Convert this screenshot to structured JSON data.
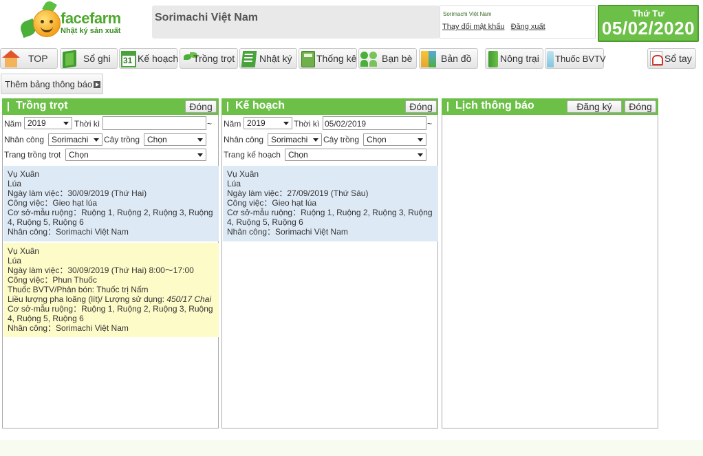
{
  "header": {
    "logo_text": "facefarm",
    "logo_sub": "Nhật ký sản xuất",
    "company": "Sorimachi Việt Nam",
    "user_name": "Sorimachi Việt Nam",
    "change_password": "Thay đổi mật khẩu",
    "logout": "Đăng xuất",
    "day_of_week": "Thứ Tư",
    "date": "05/02/2020"
  },
  "nav": {
    "top": "TOP",
    "so_ghi": "Sổ ghi",
    "ke_hoach": "Kế hoạch",
    "trong_trot": "Trồng trọt",
    "nhat_ky": "Nhật ký",
    "thong_ke": "Thống kê",
    "ban_be": "Bạn bè",
    "ban_do": "Bản đồ",
    "nong_trai": "Nông trại",
    "thuoc_bvtv": "Thuốc BVTV",
    "so_tay": "Sổ tay"
  },
  "notice_button": "Thêm bảng thông báo",
  "panels": {
    "trong_trot": {
      "title": "Trồng trọt",
      "close": "Đóng",
      "year_label": "Năm",
      "year_value": "2019",
      "period_label": "Thời kì",
      "period_value": "",
      "tilde": "~",
      "worker_label": "Nhân công",
      "worker_value": "Sorimachi",
      "crop_label": "Cây trồng",
      "crop_value": "Chọn",
      "page_label": "Trang trồng trọt",
      "page_value": "Chọn",
      "entries": [
        {
          "season": "Vụ Xuân",
          "crop": "Lúa",
          "workday": "Ngày làm việc：30/09/2019 (Thứ Hai)",
          "task": "Công việc：Gieo hạt lúa",
          "field_1": "Cơ sở-mẫu ruộng：Ruộng 1, Ruộng 2, Ruộng 3, Ruộng",
          "field_2": "4, Ruộng 5, Ruộng 6",
          "worker": "Nhân công：Sorimachi Việt Nam"
        },
        {
          "season": "Vụ Xuân",
          "crop": "Lúa",
          "workday": "Ngày làm việc：30/09/2019 (Thứ Hai)  8:00～17:00",
          "task": "Công việc：Phun Thuốc",
          "pesticide": "Thuốc BVTV/Phân bón: Thuốc trị Nấm",
          "dosage_label": "Liều lượng pha loãng (lít)/ Lượng sử dụng: ",
          "dosage_value": "450/17 Chai",
          "field_1": "Cơ sở-mẫu ruộng：Ruộng 1, Ruộng 2, Ruộng 3, Ruộng",
          "field_2": "4, Ruộng 5, Ruộng 6",
          "worker": "Nhân công：Sorimachi Việt Nam"
        }
      ]
    },
    "ke_hoach": {
      "title": "Kế hoạch",
      "close": "Đóng",
      "year_label": "Năm",
      "year_value": "2019",
      "period_label": "Thời kì",
      "period_value": "05/02/2019",
      "tilde": "~",
      "worker_label": "Nhân công",
      "worker_value": "Sorimachi",
      "crop_label": "Cây trồng",
      "crop_value": "Chọn",
      "page_label": "Trang kế hoạch",
      "page_value": "Chọn",
      "entries": [
        {
          "season": "Vụ Xuân",
          "crop": "Lúa",
          "workday": "Ngày làm việc：27/09/2019 (Thứ Sáu)",
          "task": "Công việc：Gieo hạt lúa",
          "field_1": "Cơ sở-mẫu ruộng：Ruộng 1, Ruộng 2, Ruộng 3, Ruộng",
          "field_2": "4, Ruộng 5, Ruộng 6",
          "worker": "Nhân công：Sorimachi Việt Nam"
        }
      ]
    },
    "lich_thong_bao": {
      "title": "Lịch thông báo",
      "register": "Đăng ký",
      "close": "Đóng"
    }
  }
}
